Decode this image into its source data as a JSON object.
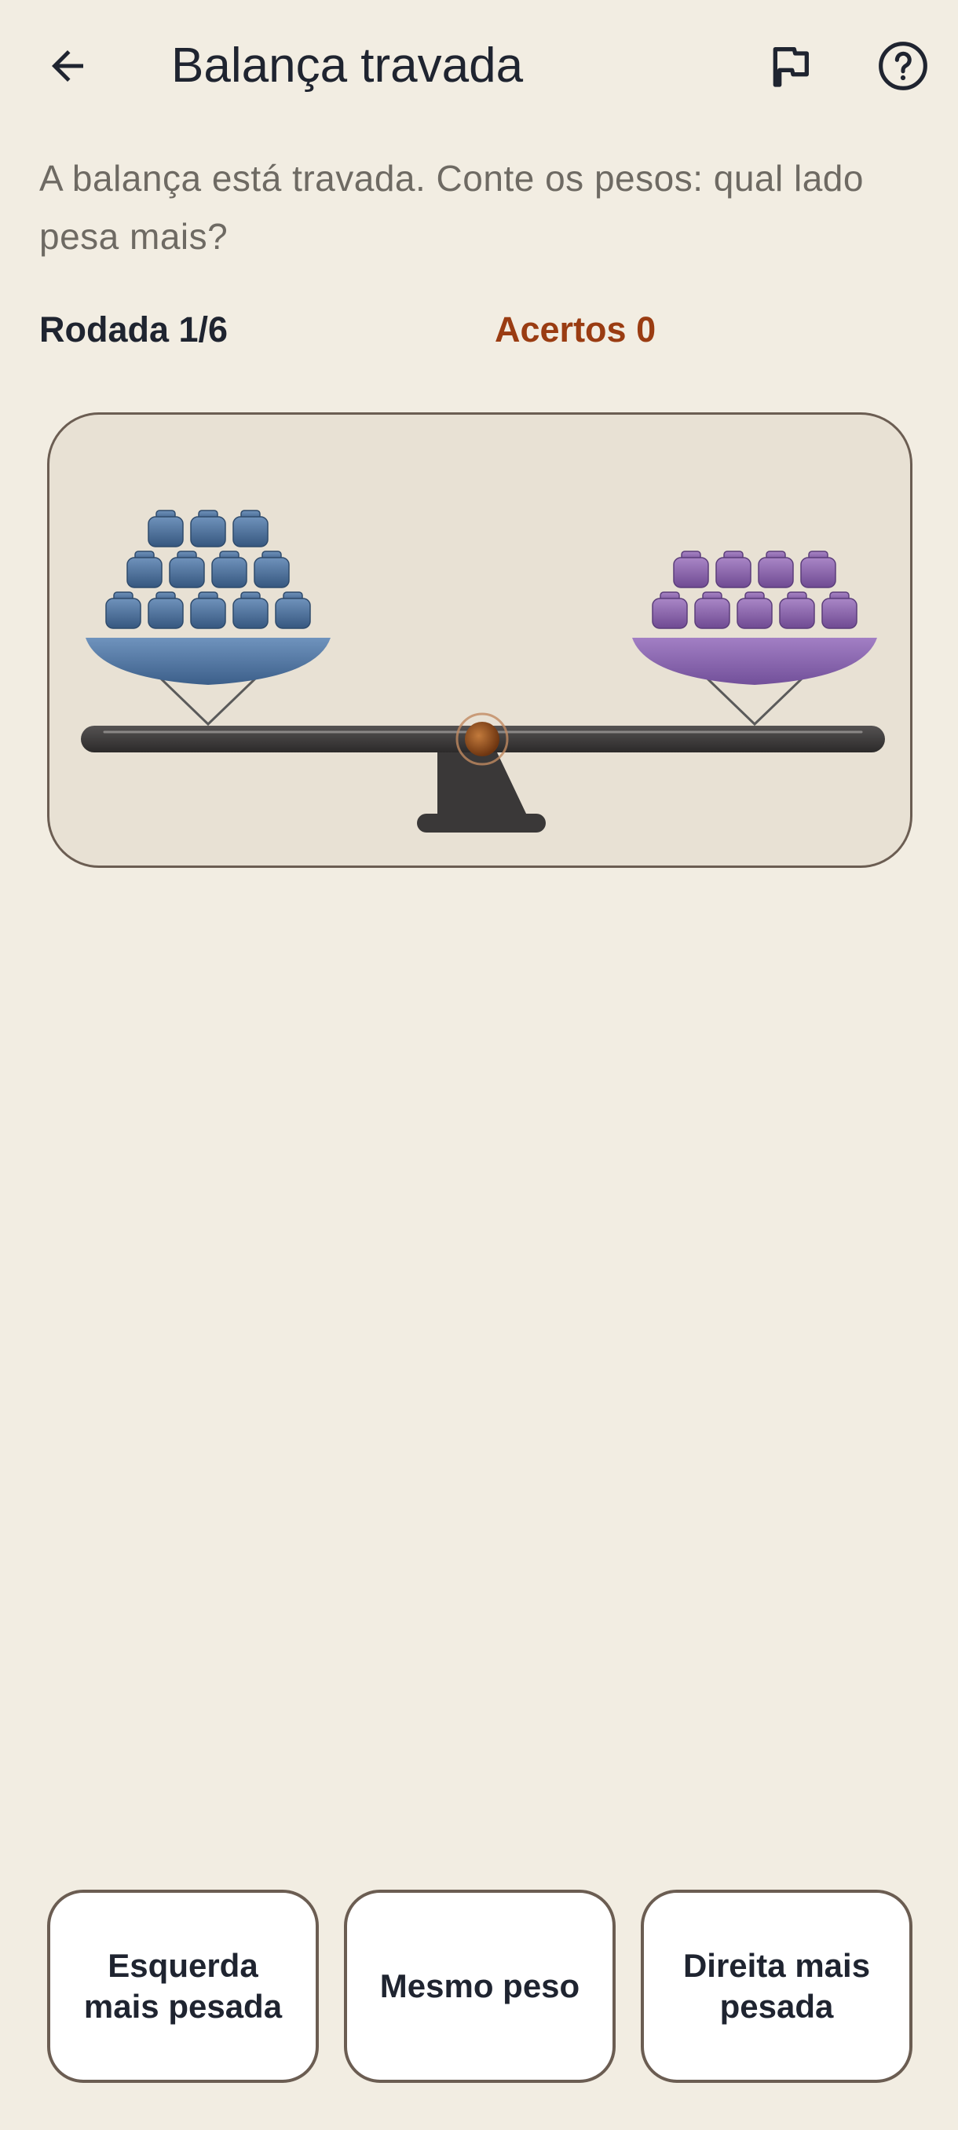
{
  "header": {
    "title": "Balança travada",
    "back_icon": "arrow-left-icon",
    "flag_icon": "flag-icon",
    "help_icon": "help-circle-icon"
  },
  "instructions": "A balança está travada. Conte os pesos: qual lado pesa mais?",
  "status": {
    "round": "Rodada 1/6",
    "score": "Acertos 0"
  },
  "scale": {
    "left_weight_count": 12,
    "right_weight_count": 9,
    "left_color": "#4a6f9a",
    "right_color": "#8a62aa",
    "beam_color": "#3a3838",
    "pivot_color": "#8b4a1a"
  },
  "answers": [
    {
      "label": "Esquerda mais pesada"
    },
    {
      "label": "Mesmo peso"
    },
    {
      "label": "Direita mais pesada"
    }
  ],
  "colors": {
    "background": "#f2ede2",
    "accent": "#9a3c12",
    "border": "#6b5d52"
  }
}
